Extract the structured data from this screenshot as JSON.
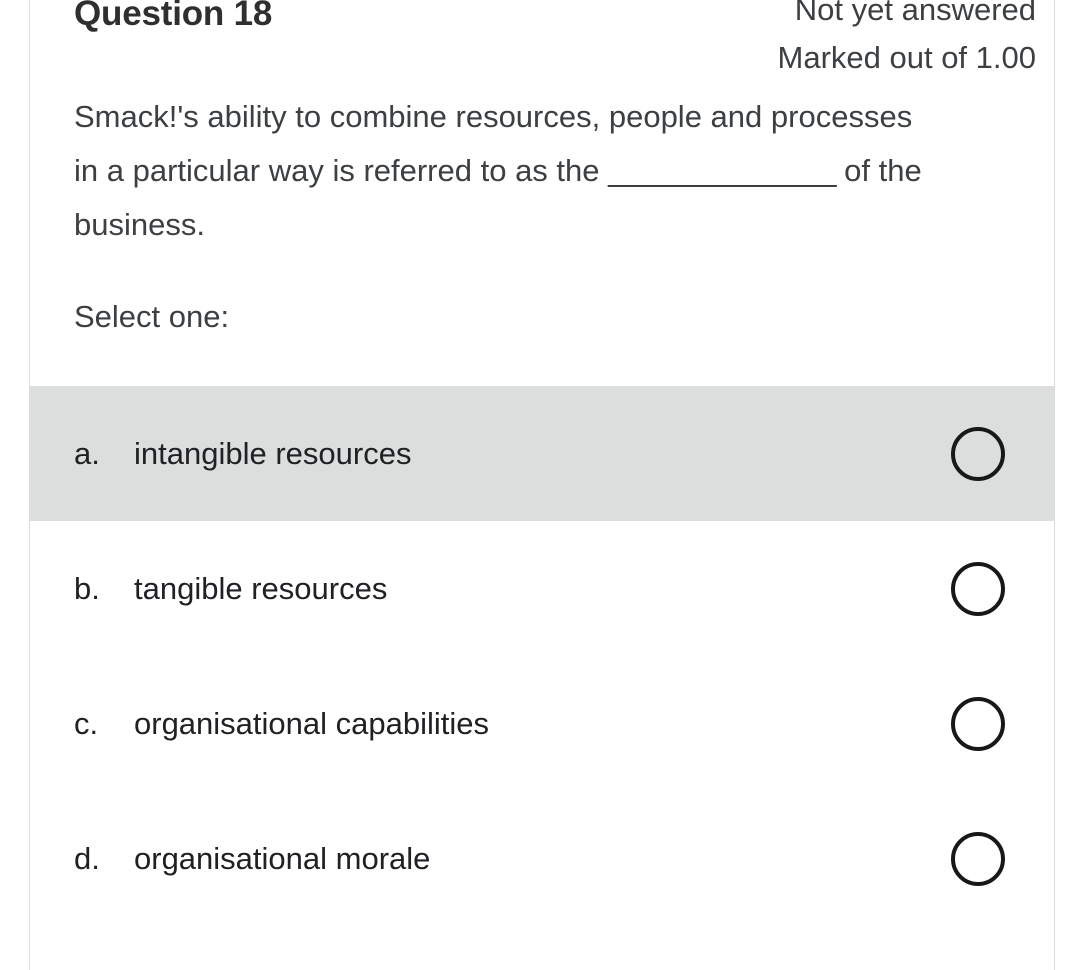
{
  "question": {
    "title": "Question 18",
    "status": "Not yet answered",
    "marks": "Marked out of 1.00",
    "text_line1": "Smack!'s ability to combine resources, people and",
    "text_line2": "processes in a particular way is referred to as the",
    "blank": "______________",
    "text_line3": " of the business.",
    "prompt": "Select one:"
  },
  "answers": [
    {
      "letter": "a.",
      "text": "intangible resources",
      "highlighted": true,
      "selected": false
    },
    {
      "letter": "b.",
      "text": "tangible resources",
      "highlighted": false,
      "selected": false
    },
    {
      "letter": "c.",
      "text": "organisational capabilities",
      "highlighted": false,
      "selected": false
    },
    {
      "letter": "d.",
      "text": "organisational morale",
      "highlighted": false,
      "selected": false
    }
  ],
  "colors": {
    "text": "#3c4043",
    "title": "#2d2f31",
    "highlight": "#dcdddd",
    "border": "#dddddd",
    "radio": "#17181a"
  }
}
